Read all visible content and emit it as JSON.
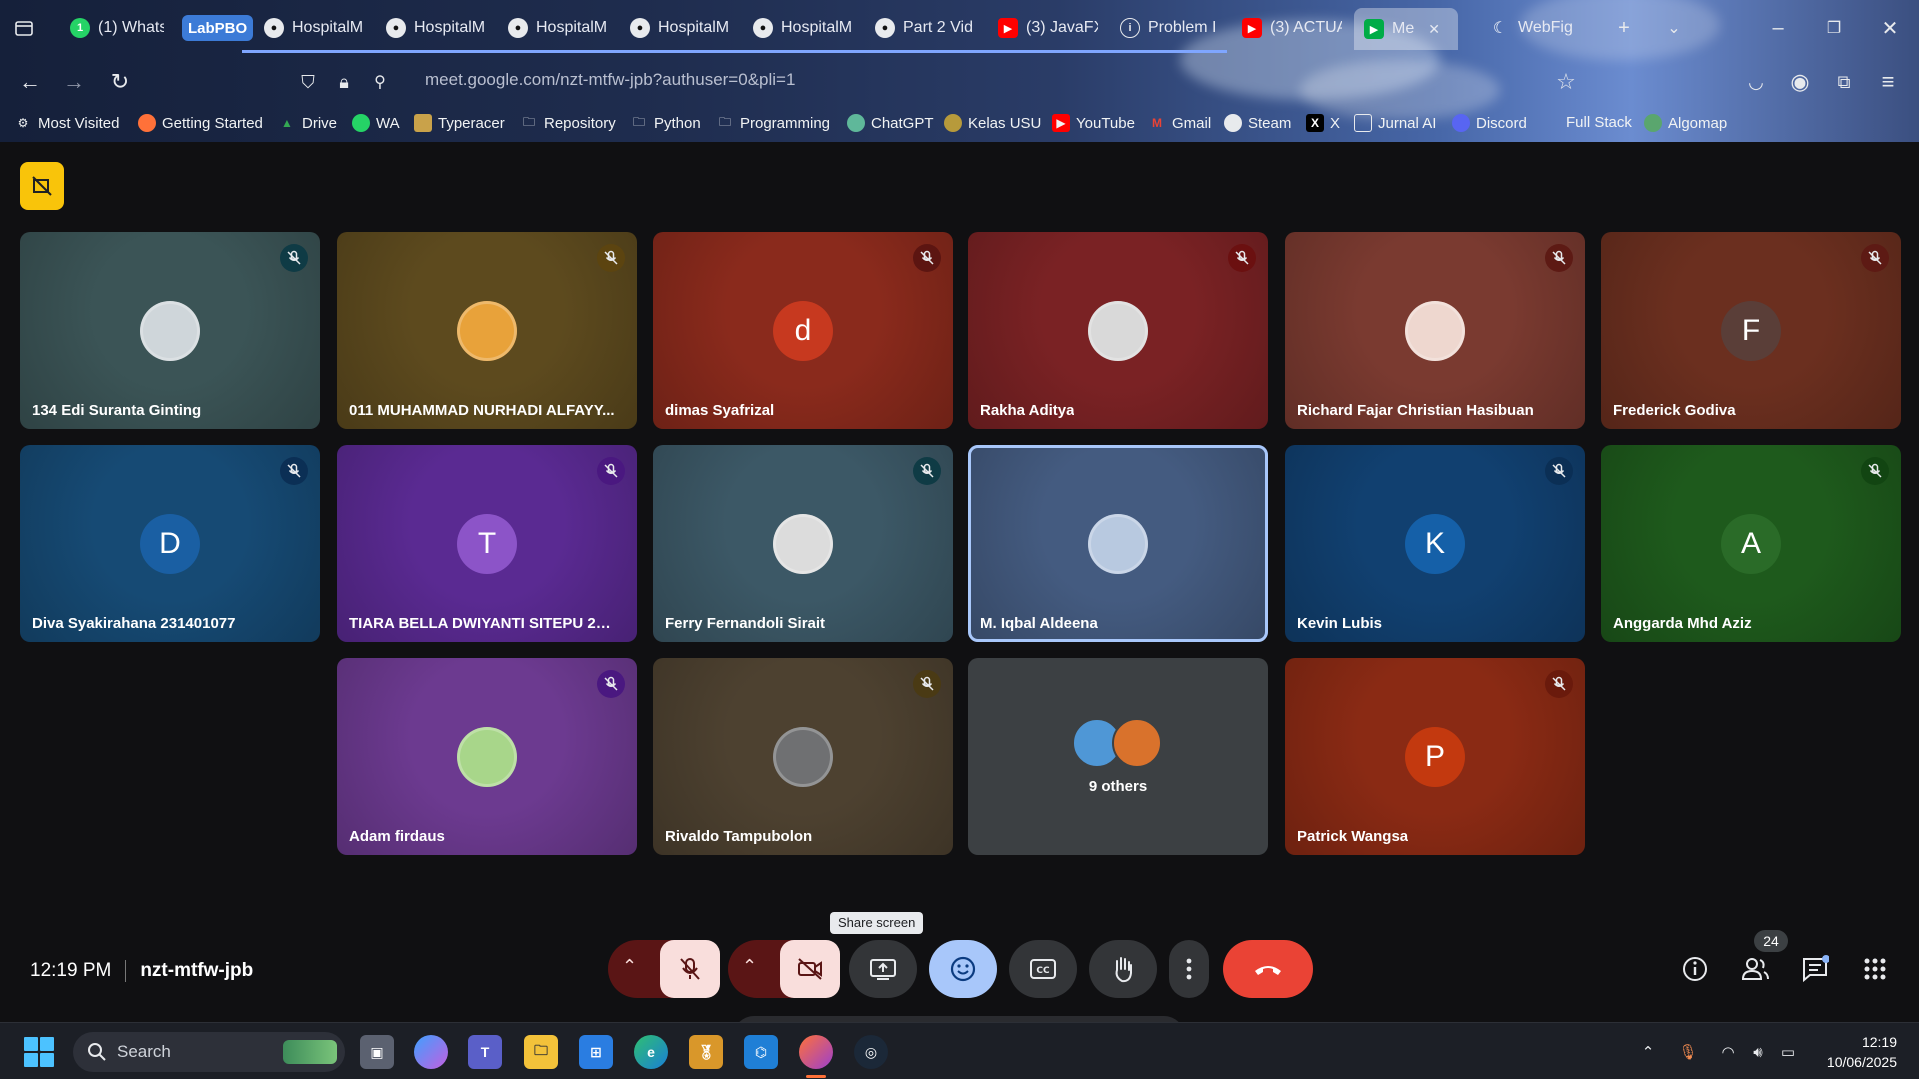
{
  "browser": {
    "tabs": [
      {
        "label": "(1) Whats/",
        "icon": "whatsapp-icon"
      },
      {
        "label": "LabPBO",
        "icon": "none"
      },
      {
        "label": "HospitalM",
        "icon": "github-icon"
      },
      {
        "label": "HospitalM",
        "icon": "github-icon"
      },
      {
        "label": "HospitalM",
        "icon": "github-icon"
      },
      {
        "label": "HospitalM",
        "icon": "github-icon"
      },
      {
        "label": "HospitalM",
        "icon": "github-icon"
      },
      {
        "label": "Part 2 Vid",
        "icon": "github-icon"
      },
      {
        "label": "(3) JavaFX",
        "icon": "youtube-icon"
      },
      {
        "label": "Problem I",
        "icon": "info-icon"
      },
      {
        "label": "(3) ACTUA",
        "icon": "youtube-icon"
      },
      {
        "label": "Me",
        "icon": "meet-icon",
        "active": true
      },
      {
        "label": "WebFig",
        "icon": "webfig-icon"
      }
    ],
    "url_host": "meet.google.com",
    "url_path": "/nzt-mtfw-jpb?authuser=0&pli=1",
    "bookmarks": [
      {
        "label": "Most Visited",
        "icon": "gear-icon"
      },
      {
        "label": "Getting Started",
        "icon": "firefox-icon"
      },
      {
        "label": "Drive",
        "icon": "drive-icon"
      },
      {
        "label": "WA",
        "icon": "whatsapp-icon"
      },
      {
        "label": "Typeracer",
        "icon": "typeracer-icon"
      },
      {
        "label": "Repository",
        "icon": "folder-icon"
      },
      {
        "label": "Python",
        "icon": "folder-icon"
      },
      {
        "label": "Programming",
        "icon": "folder-icon"
      },
      {
        "label": "ChatGPT",
        "icon": "chatgpt-icon"
      },
      {
        "label": "Kelas USU",
        "icon": "usu-icon"
      },
      {
        "label": "YouTube",
        "icon": "youtube-icon"
      },
      {
        "label": "Gmail",
        "icon": "gmail-icon"
      },
      {
        "label": "Steam",
        "icon": "steam-icon"
      },
      {
        "label": "X",
        "icon": "x-icon"
      },
      {
        "label": "Jurnal AI",
        "icon": "jurnal-icon"
      },
      {
        "label": "Discord",
        "icon": "discord-icon"
      },
      {
        "label": "Full Stack",
        "icon": "none"
      },
      {
        "label": "Algomap",
        "icon": "algomap-icon"
      }
    ]
  },
  "meet": {
    "participants": [
      {
        "name": "134 Edi Suranta Ginting",
        "initial": "",
        "bg": "#3b5456",
        "avatar": "#cfd6da"
      },
      {
        "name": "011 MUHAMMAD NURHADI ALFAYY...",
        "initial": "",
        "bg": "#5d4a1e",
        "avatar": "#e8a23a"
      },
      {
        "name": "dimas Syafrizal",
        "initial": "d",
        "bg": "#8a2a1c",
        "avatar": "#c7391f"
      },
      {
        "name": "Rakha Aditya",
        "initial": "",
        "bg": "#7a2224",
        "avatar": "#d9d9d9"
      },
      {
        "name": "Richard Fajar Christian Hasibuan",
        "initial": "",
        "bg": "#7a3a30",
        "avatar": "#eed7cf"
      },
      {
        "name": "Frederick Godiva",
        "initial": "F",
        "bg": "#6b2f1f",
        "avatar": "#5a3e38"
      },
      {
        "name": "Diva Syakirahana 231401077",
        "initial": "D",
        "bg": "#164a74",
        "avatar": "#1a5fa3"
      },
      {
        "name": "TIARA BELLA DWIYANTI SITEPU 231...",
        "initial": "T",
        "bg": "#5a2a92",
        "avatar": "#8c54c8"
      },
      {
        "name": "Ferry Fernandoli Sirait",
        "initial": "",
        "bg": "#3c5866",
        "avatar": "#dcdcdc"
      },
      {
        "name": "M. Iqbal Aldeena",
        "initial": "",
        "bg": "#445b80",
        "avatar": "#b8c9e0",
        "selected": true
      },
      {
        "name": "Kevin Lubis",
        "initial": "K",
        "bg": "#114070",
        "avatar": "#1560a8"
      },
      {
        "name": "Anggarda Mhd Aziz",
        "initial": "A",
        "bg": "#1e5a1c",
        "avatar": "#2a6b28"
      },
      {
        "name": "Adam firdaus",
        "initial": "",
        "bg": "#6c3a90",
        "avatar": "#a8d68a"
      },
      {
        "name": "Rivaldo Tampubolon",
        "initial": "",
        "bg": "#4d4130",
        "avatar": "#6f7072"
      },
      {
        "name": "Patrick Wangsa",
        "initial": "P",
        "bg": "#8a2a14",
        "avatar": "#c3390f"
      }
    ],
    "others_label": "9 others",
    "reactions": [
      "💖",
      "👍",
      "🎉",
      "👏",
      "😂",
      "😮",
      "😢",
      "🤔",
      "👎"
    ],
    "tooltip": "Share screen",
    "time": "12:19 PM",
    "meeting_code": "nzt-mtfw-jpb",
    "people_count": "24"
  },
  "taskbar": {
    "search_placeholder": "Search",
    "time": "12:19",
    "date": "10/06/2025"
  }
}
